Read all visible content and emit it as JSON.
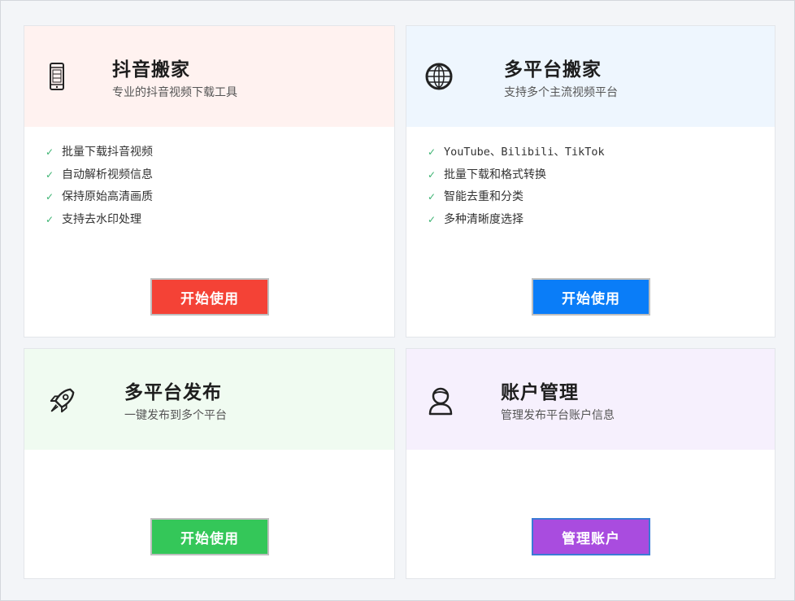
{
  "cards": [
    {
      "title": "抖音搬家",
      "subtitle": "专业的抖音视频下载工具",
      "icon": "phone-icon",
      "header_bg": "#fff2f0",
      "features": [
        "批量下载抖音视频",
        "自动解析视频信息",
        "保持原始高清画质",
        "支持去水印处理"
      ],
      "button": {
        "label": "开始使用",
        "color": "#f44236"
      }
    },
    {
      "title": "多平台搬家",
      "subtitle": "支持多个主流视频平台",
      "icon": "globe-icon",
      "header_bg": "#eef6fe",
      "features": [
        "YouTube、Bilibili、TikTok",
        "批量下载和格式转换",
        "智能去重和分类",
        "多种清晰度选择"
      ],
      "button": {
        "label": "开始使用",
        "color": "#0a7df8"
      }
    },
    {
      "title": "多平台发布",
      "subtitle": "一键发布到多个平台",
      "icon": "rocket-icon",
      "header_bg": "#f0fbf1",
      "features": [],
      "button": {
        "label": "开始使用",
        "color": "#34c759"
      }
    },
    {
      "title": "账户管理",
      "subtitle": "管理发布平台账户信息",
      "icon": "user-icon",
      "header_bg": "#f6f0fd",
      "features": [],
      "button": {
        "label": "管理账户",
        "color": "#a94cdf"
      }
    }
  ]
}
